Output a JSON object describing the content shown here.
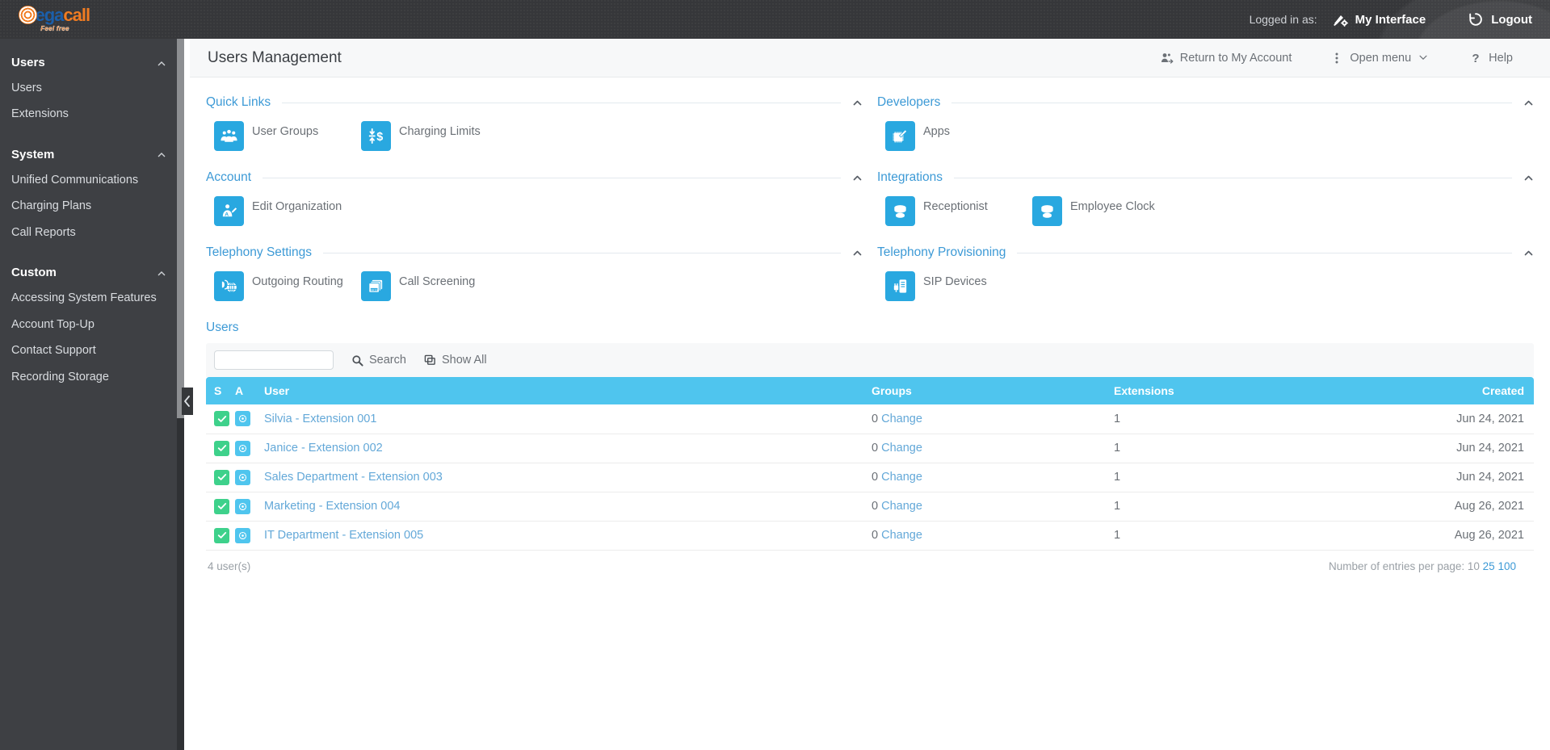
{
  "topbar": {
    "logo": {
      "mega": "mega",
      "call": "call",
      "tagline": "Feel free"
    },
    "logged_label": "Logged in as:",
    "my_interface": "My Interface",
    "logout": "Logout"
  },
  "sidebar": {
    "groups": [
      {
        "title": "Users",
        "items": [
          {
            "label": "Users"
          },
          {
            "label": "Extensions"
          }
        ]
      },
      {
        "title": "System",
        "items": [
          {
            "label": "Unified Communications"
          },
          {
            "label": "Charging Plans"
          },
          {
            "label": "Call Reports"
          }
        ]
      },
      {
        "title": "Custom",
        "items": [
          {
            "label": "Accessing System Features"
          },
          {
            "label": "Account Top-Up"
          },
          {
            "label": "Contact Support"
          },
          {
            "label": "Recording Storage"
          }
        ]
      }
    ]
  },
  "page": {
    "title": "Users Management",
    "actions": [
      {
        "label": "Return to My Account",
        "icon": "return-account-icon"
      },
      {
        "label": "Open menu",
        "icon": "kebab-icon"
      },
      {
        "label": "Help",
        "icon": "question-icon"
      }
    ]
  },
  "sections": {
    "left": [
      {
        "title": "Quick Links",
        "tiles": [
          {
            "label": "User Groups",
            "icon": "user-groups-icon"
          },
          {
            "label": "Charging Limits",
            "icon": "charging-limits-icon"
          }
        ]
      },
      {
        "title": "Account",
        "tiles": [
          {
            "label": "Edit Organization",
            "icon": "edit-organization-icon"
          }
        ]
      },
      {
        "title": "Telephony Settings",
        "tiles": [
          {
            "label": "Outgoing Routing",
            "icon": "outgoing-routing-icon"
          },
          {
            "label": "Call Screening",
            "icon": "call-screening-icon"
          }
        ]
      }
    ],
    "right": [
      {
        "title": "Developers",
        "tiles": [
          {
            "label": "Apps",
            "icon": "apps-icon"
          }
        ]
      },
      {
        "title": "Integrations",
        "tiles": [
          {
            "label": "Receptionist",
            "icon": "receptionist-icon"
          },
          {
            "label": "Employee Clock",
            "icon": "employee-clock-icon"
          }
        ]
      },
      {
        "title": "Telephony Provisioning",
        "tiles": [
          {
            "label": "SIP Devices",
            "icon": "sip-devices-icon"
          }
        ]
      }
    ]
  },
  "users": {
    "heading": "Users",
    "search": {
      "value": "",
      "placeholder": ""
    },
    "search_button": "Search",
    "show_all_button": "Show All",
    "columns": [
      "S",
      "A",
      "User",
      "Groups",
      "Extensions",
      "Created"
    ],
    "change_label": "Change",
    "rows": [
      {
        "status": true,
        "admin": true,
        "user": "Silvia - Extension 001",
        "groups": "0",
        "extensions": "1",
        "created": "Jun 24, 2021"
      },
      {
        "status": true,
        "admin": true,
        "user": "Janice - Extension 002",
        "groups": "0",
        "extensions": "1",
        "created": "Jun 24, 2021"
      },
      {
        "status": true,
        "admin": true,
        "user": "Sales Department - Extension 003",
        "groups": "0",
        "extensions": "1",
        "created": "Jun 24, 2021"
      },
      {
        "status": true,
        "admin": true,
        "user": "Marketing - Extension 004",
        "groups": "0",
        "extensions": "1",
        "created": "Aug 26, 2021"
      },
      {
        "status": true,
        "admin": true,
        "user": "IT Department - Extension 005",
        "groups": "0",
        "extensions": "1",
        "created": "Aug 26, 2021"
      }
    ],
    "count_label": "4 user(s)",
    "per_page_label": "Number of entries per page:",
    "per_page_options": [
      "10",
      "25",
      "100"
    ],
    "per_page_current": "10"
  },
  "colors": {
    "accent_blue": "#29a8e0",
    "table_header": "#4fc5ee",
    "link_blue": "#3d9ad6",
    "green_check": "#3ed18b",
    "sidebar_bg": "#3e4044",
    "topbar_bg": "#36373a"
  }
}
